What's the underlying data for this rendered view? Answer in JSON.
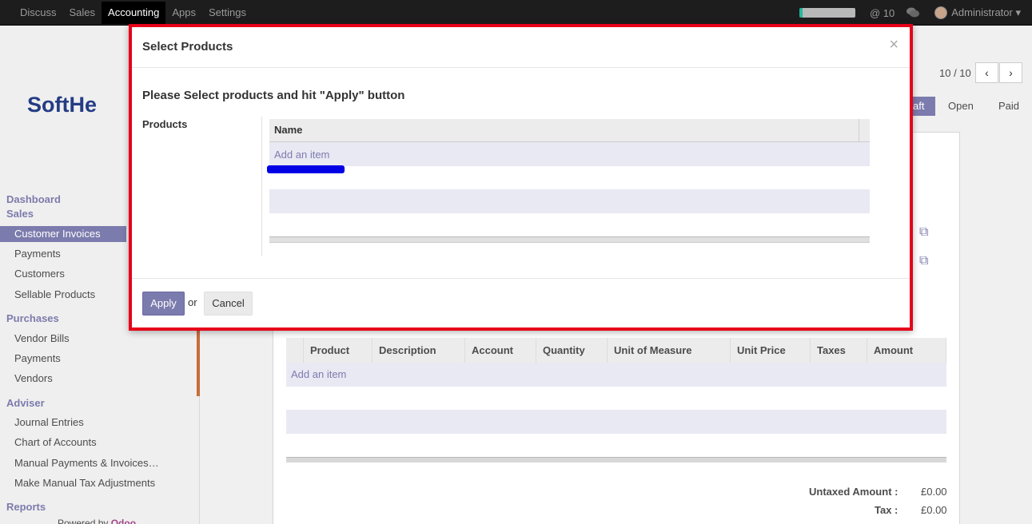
{
  "topbar": {
    "menu": [
      "Discuss",
      "Sales",
      "Accounting",
      "Apps",
      "Settings"
    ],
    "active_menu": "Accounting",
    "mentions": "@ 10",
    "user": "Administrator"
  },
  "sidebar": {
    "logo_text": "SoftHe",
    "dashboard": "Dashboard",
    "sales": "Sales",
    "sales_items": [
      "Customer Invoices",
      "Payments",
      "Customers",
      "Sellable Products"
    ],
    "purchases": "Purchases",
    "purchases_items": [
      "Vendor Bills",
      "Payments",
      "Vendors"
    ],
    "adviser": "Adviser",
    "adviser_items": [
      "Journal Entries",
      "Chart of Accounts",
      "Manual Payments & Invoices…",
      "Make Manual Tax Adjustments"
    ],
    "reports": "Reports",
    "powered_by": "Powered by",
    "powered_brand": "Odoo"
  },
  "main": {
    "pager": "10 / 10",
    "status": [
      "aft",
      "Open",
      "Paid"
    ],
    "lines_columns": [
      "Product",
      "Description",
      "Account",
      "Quantity",
      "Unit of Measure",
      "Unit Price",
      "Taxes",
      "Amount"
    ],
    "add_item": "Add an item",
    "untaxed_label": "Untaxed Amount :",
    "untaxed_value": "£0.00",
    "tax_label": "Tax :",
    "tax_value": "£0.00"
  },
  "modal": {
    "title": "Select Products",
    "close": "×",
    "instructions": "Please Select products and hit \"Apply\" button",
    "field_label": "Products",
    "column_name": "Name",
    "add_item": "Add an item",
    "apply_label": "Apply",
    "or_text": "or",
    "cancel_label": "Cancel"
  },
  "colors": {
    "accent": "#7c7bad",
    "highlight_border": "#e6001a",
    "annotation": "#0000e6"
  }
}
